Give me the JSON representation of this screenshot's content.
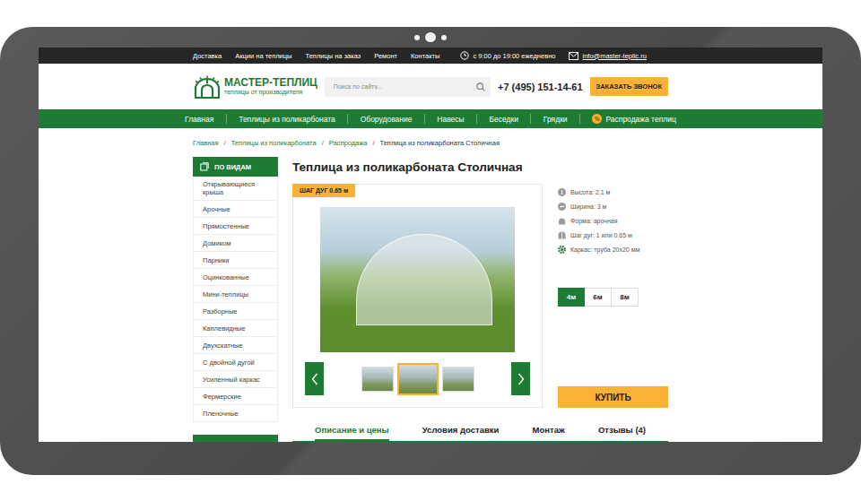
{
  "topbar": {
    "links": [
      "Доставка",
      "Акции на теплицы",
      "Теплицы на заказ",
      "Ремонт",
      "Контакты"
    ],
    "hours": "с 9:00 до 19:00 ежедневно",
    "email": "info@master-teplic.ru"
  },
  "header": {
    "logo_title": "МАСТЕР-ТЕПЛИЦ",
    "logo_subtitle": "теплицы от производителя",
    "search": {
      "placeholder": "Поиск по сайту..."
    },
    "phone": "+7 (495) 151-14-61",
    "callback_button": "ЗАКАЗАТЬ ЗВОНОК"
  },
  "nav": [
    {
      "label": "Главная",
      "kind": "link"
    },
    {
      "label": "Теплицы из поликарбоната",
      "kind": "link"
    },
    {
      "label": "Оборудование",
      "kind": "link"
    },
    {
      "label": "Навесы",
      "kind": "link"
    },
    {
      "label": "Беседки",
      "kind": "link"
    },
    {
      "label": "Грядки",
      "kind": "link"
    },
    {
      "label": "Распродажа теплиц",
      "kind": "sale",
      "icon": "%"
    }
  ],
  "breadcrumbs": {
    "separator": "/",
    "items": [
      "Главная",
      "Теплицы из поликарбоната",
      "Распродажа",
      "Теплица из поликарбоната Столичная"
    ]
  },
  "sidebar": {
    "title": "ПО ВИДАМ",
    "items": [
      "Открывающиеся крыша",
      "Арочные",
      "Прямостенные",
      "Домиком",
      "Парники",
      "Оцинкованные",
      "Мини-теплицы",
      "Разборные",
      "Каплевидные",
      "Двухскатные",
      "С двойной дугой",
      "Усиленный каркас",
      "Фермерские",
      "Пленочные"
    ]
  },
  "product": {
    "title": "Теплица из поликарбоната Столичная",
    "badge": "ШАГ ДУГ 0.65 м",
    "thumbnails": [
      {
        "selected": false
      },
      {
        "selected": true
      },
      {
        "selected": false
      }
    ],
    "specs": [
      "Высота: 2.1 м",
      "Ширина: 3 м",
      "Форма: арочная",
      "Шаг дуг: 1 или 0.65 м",
      "Каркас: труба 20x20 мм"
    ],
    "sizes": [
      {
        "label": "4м",
        "selected": true
      },
      {
        "label": "6м",
        "selected": false
      },
      {
        "label": "8м",
        "selected": false
      }
    ],
    "buy_button": "КУПИТЬ"
  },
  "tabs": [
    {
      "label": "Описание и цены",
      "selected": true
    },
    {
      "label": "Условия доставки",
      "selected": false
    },
    {
      "label": "Монтаж",
      "selected": false
    },
    {
      "label": "Отзывы (4)",
      "selected": false
    }
  ]
}
